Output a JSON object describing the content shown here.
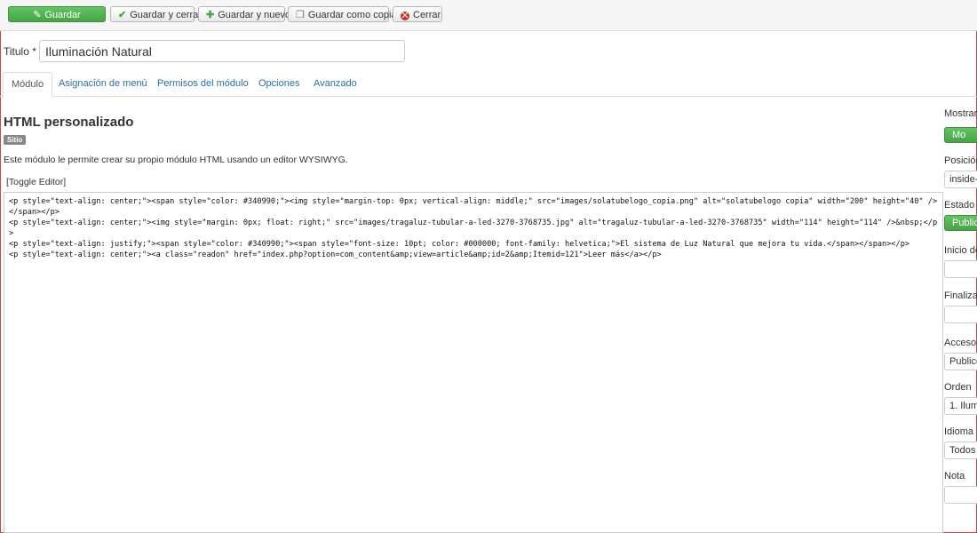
{
  "toolbar": {
    "save": "Guardar",
    "save_close": "Guardar y cerrar",
    "save_new": "Guardar y nuevo",
    "save_copy": "Guardar como copia",
    "close": "Cerrar"
  },
  "title_field": {
    "label": "Titulo *",
    "value": "Iluminación Natural"
  },
  "tabs": [
    {
      "label": "Módulo"
    },
    {
      "label": "Asignación de menú"
    },
    {
      "label": "Permisos del módulo"
    },
    {
      "label": "Opciones"
    },
    {
      "label": "Avanzado"
    }
  ],
  "module": {
    "title": "HTML personalizado",
    "badge": "Sitio",
    "description": "Este módulo le permite crear su propio módulo HTML usando un editor WYSIWYG.",
    "toggle_editor": "[Toggle Editor]",
    "code": "<p style=\"text-align: center;\"><span style=\"color: #340990;\"><img style=\"margin-top: 0px; vertical-align: middle;\" src=\"images/solatubelogo_copia.png\" alt=\"solatubelogo copia\" width=\"200\" height=\"40\" /></span></p>\n<p style=\"text-align: center;\"><img style=\"margin: 0px; float: right;\" src=\"images/tragaluz-tubular-a-led-3270-3768735.jpg\" alt=\"tragaluz-tubular-a-led-3270-3768735\" width=\"114\" height=\"114\" />&nbsp;</p>\n<p style=\"text-align: justify;\"><span style=\"color: #340990;\"><span style=\"font-size: 10pt; color: #000000; font-family: helvetica;\">El sistema de Luz Natural que mejora tu vida.</span></span></p>\n<p style=\"text-align: center;\"><a class=\"readon\" href=\"index.php?option=com_content&amp;view=article&amp;id=2&amp;Itemid=121\">Leer más</a></p>"
  },
  "sidebar": {
    "show_title_label": "Mostrar",
    "show_title_value": "Mo",
    "position_label": "Posición",
    "position_value": "inside-",
    "status_label": "Estado",
    "status_value": "Publica",
    "start_label": "Inicio de",
    "finish_label": "Finalizac",
    "access_label": "Acceso",
    "access_value": "Publico",
    "order_label": "Orden",
    "order_value": "1. Ilum",
    "language_label": "Idioma",
    "language_value": "Todos",
    "note_label": "Nota"
  },
  "colors": {
    "success": "#47a447",
    "link": "#2a6fa6",
    "danger": "#c9302c"
  }
}
